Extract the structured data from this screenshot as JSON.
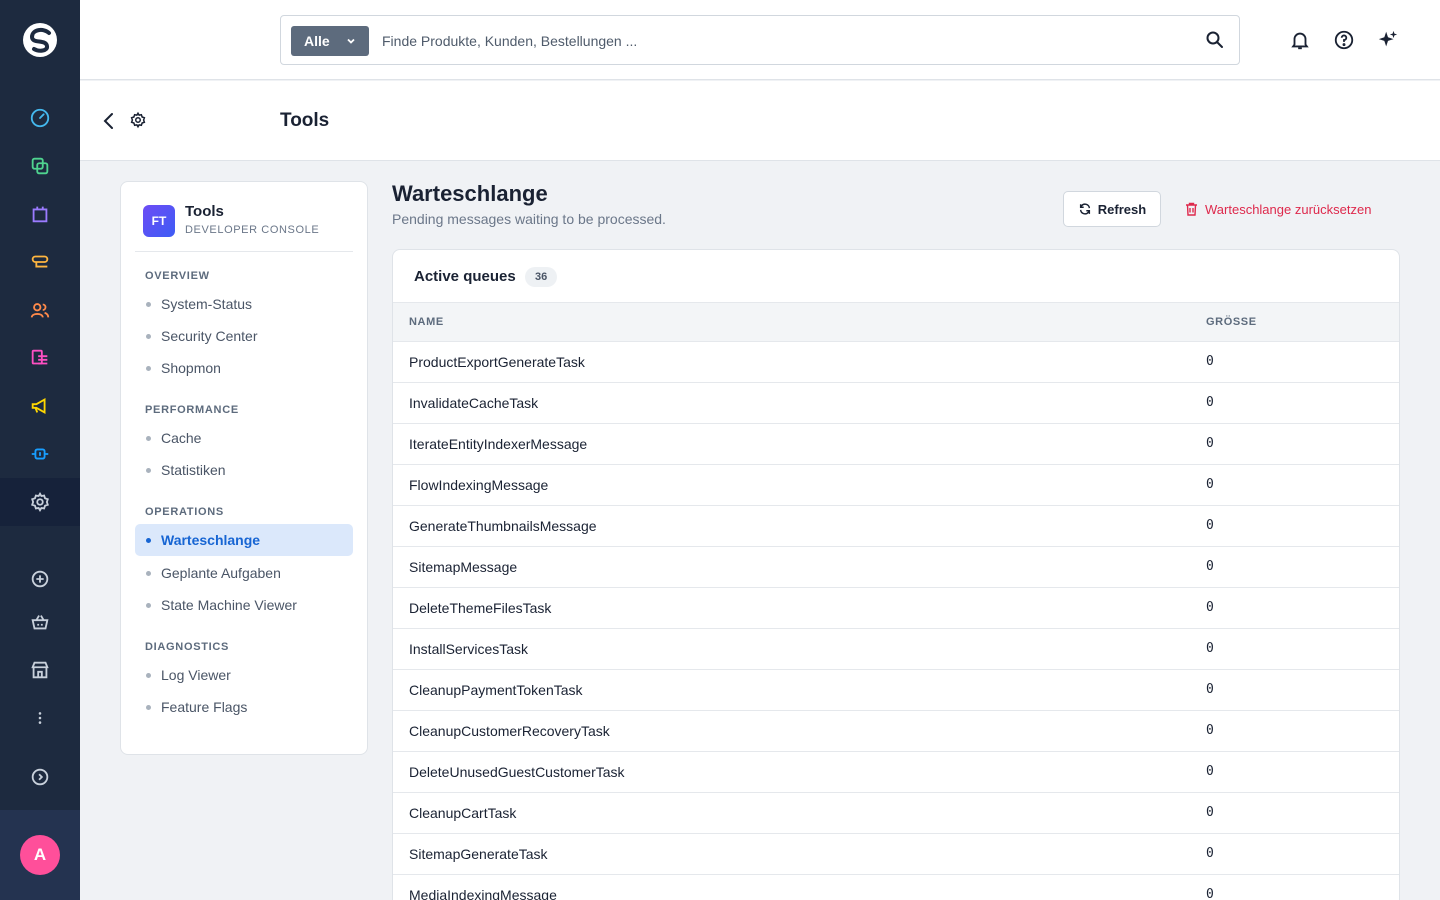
{
  "search": {
    "type_label": "Alle",
    "placeholder": "Finde Produkte, Kunden, Bestellungen ..."
  },
  "smartbar": {
    "title": "Tools"
  },
  "sidebar": {
    "brand_initials": "FT",
    "brand_title": "Tools",
    "brand_subtitle": "DEVELOPER CONSOLE",
    "sections": [
      {
        "label": "OVERVIEW",
        "items": [
          "System-Status",
          "Security Center",
          "Shopmon"
        ]
      },
      {
        "label": "PERFORMANCE",
        "items": [
          "Cache",
          "Statistiken"
        ]
      },
      {
        "label": "OPERATIONS",
        "items": [
          "Warteschlange",
          "Geplante Aufgaben",
          "State Machine Viewer"
        ]
      },
      {
        "label": "DIAGNOSTICS",
        "items": [
          "Log Viewer",
          "Feature Flags"
        ]
      }
    ],
    "active_item": "Warteschlange"
  },
  "main": {
    "title": "Warteschlange",
    "subtitle": "Pending messages waiting to be processed.",
    "refresh_label": "Refresh",
    "reset_label": "Warteschlange zurücksetzen",
    "card_title": "Active queues",
    "count": "36",
    "columns": [
      "NAME",
      "GRÖSSE"
    ],
    "rows": [
      {
        "name": "ProductExportGenerateTask",
        "size": "0"
      },
      {
        "name": "InvalidateCacheTask",
        "size": "0"
      },
      {
        "name": "IterateEntityIndexerMessage",
        "size": "0"
      },
      {
        "name": "FlowIndexingMessage",
        "size": "0"
      },
      {
        "name": "GenerateThumbnailsMessage",
        "size": "0"
      },
      {
        "name": "SitemapMessage",
        "size": "0"
      },
      {
        "name": "DeleteThemeFilesTask",
        "size": "0"
      },
      {
        "name": "InstallServicesTask",
        "size": "0"
      },
      {
        "name": "CleanupPaymentTokenTask",
        "size": "0"
      },
      {
        "name": "CleanupCustomerRecoveryTask",
        "size": "0"
      },
      {
        "name": "DeleteUnusedGuestCustomerTask",
        "size": "0"
      },
      {
        "name": "CleanupCartTask",
        "size": "0"
      },
      {
        "name": "SitemapGenerateTask",
        "size": "0"
      },
      {
        "name": "MediaIndexingMessage",
        "size": "0"
      }
    ]
  },
  "user": {
    "avatar_initial": "A"
  },
  "colors": {
    "rail": "#1d2a3f",
    "accent": "#1765d3",
    "danger": "#de294c",
    "avatar": "#ff4f9a"
  },
  "icons": {
    "rail": [
      "dashboard-icon",
      "catalog-icon",
      "orders-icon",
      "customers-flow-icon",
      "customers-icon",
      "content-icon",
      "marketing-icon",
      "extensions-icon",
      "settings-icon",
      "add-circle-icon",
      "basket-icon",
      "store-icon",
      "more-icon",
      "expand-icon"
    ],
    "top": [
      "bell-icon",
      "help-icon",
      "sparkle-icon"
    ]
  }
}
